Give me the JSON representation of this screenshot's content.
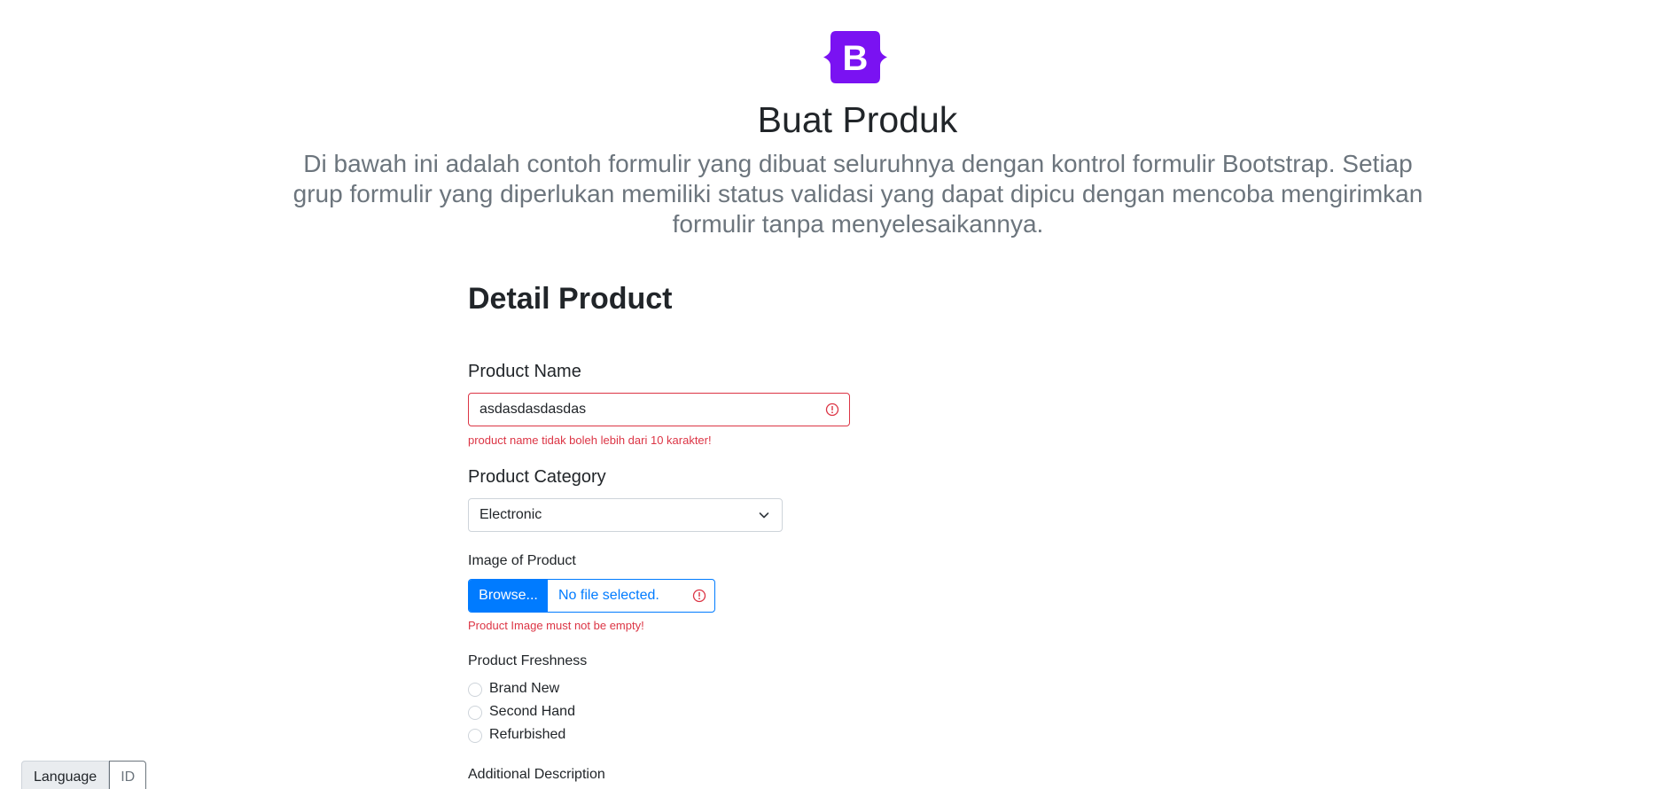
{
  "header": {
    "logo_letter": "B",
    "brand_color": "#7a12f2",
    "title": "Buat Produk",
    "lead": "Di bawah ini adalah contoh formulir yang dibuat seluruhnya dengan kontrol formulir Bootstrap. Setiap grup formulir yang diperlukan memiliki status validasi yang dapat dipicu dengan mencoba mengirimkan formulir tanpa menyelesaikannya."
  },
  "form": {
    "section_title": "Detail Product",
    "product_name": {
      "label": "Product Name",
      "value": "asdasdasdasdas",
      "error": "product name tidak boleh lebih dari 10 karakter!"
    },
    "product_category": {
      "label": "Product Category",
      "selected": "Electronic"
    },
    "product_image": {
      "label": "Image of Product",
      "button_label": "Browse...",
      "file_text": "No file selected.",
      "error": "Product Image must not be empty!"
    },
    "product_freshness": {
      "label": "Product Freshness",
      "options": [
        "Brand New",
        "Second Hand",
        "Refurbished"
      ]
    },
    "additional_description": {
      "label": "Additional Description"
    }
  },
  "language": {
    "label": "Language",
    "value": "ID"
  },
  "colors": {
    "danger": "#dc3545",
    "primary": "#007bff",
    "muted": "#6c757d"
  }
}
